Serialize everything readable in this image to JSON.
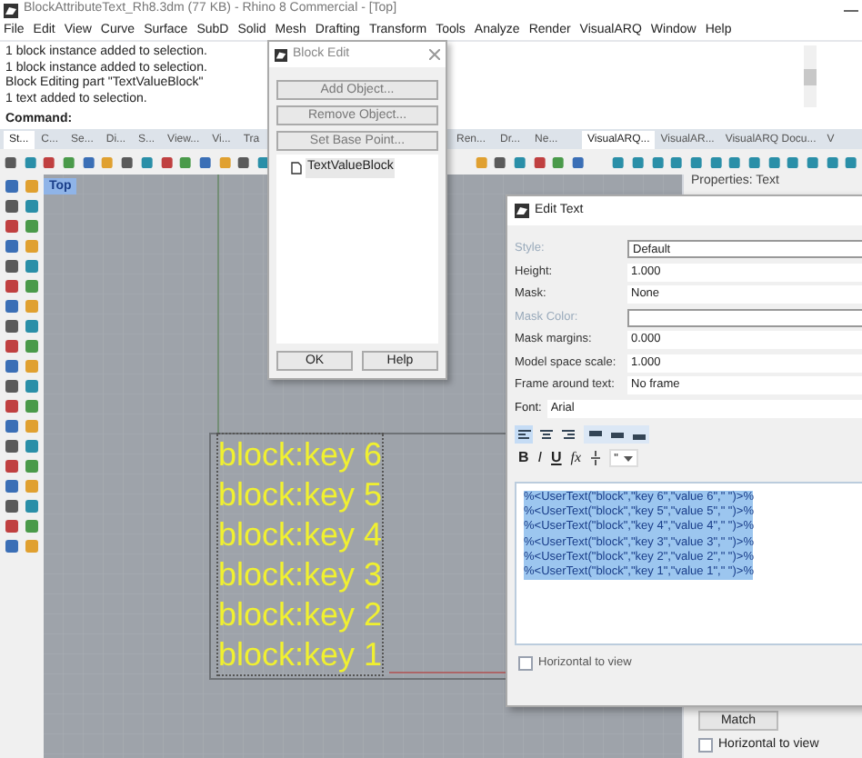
{
  "window": {
    "title": "BlockAttributeText_Rh8.3dm (77 KB) - Rhino 8 Commercial - [Top]"
  },
  "menu": [
    "File",
    "Edit",
    "View",
    "Curve",
    "Surface",
    "SubD",
    "Solid",
    "Mesh",
    "Drafting",
    "Transform",
    "Tools",
    "Analyze",
    "Render",
    "VisualARQ",
    "Window",
    "Help"
  ],
  "command_history": [
    "1 block instance added to selection.",
    "1 block instance added to selection.",
    "Block Editing part \"TextValueBlock\"",
    "1 text added to selection."
  ],
  "command_prompt": "Command:",
  "toolbar_tabs_left": [
    {
      "label": "St...",
      "selected": true
    },
    {
      "label": "C...",
      "selected": false
    },
    {
      "label": "Se...",
      "selected": false
    },
    {
      "label": "Di...",
      "selected": false
    },
    {
      "label": "S...",
      "selected": false
    },
    {
      "label": "View...",
      "selected": false
    },
    {
      "label": "Vi...",
      "selected": false
    },
    {
      "label": "Tra",
      "selected": false
    }
  ],
  "toolbar_tabs_middle": [
    {
      "label": "Ren...",
      "selected": false
    },
    {
      "label": "Dr...",
      "selected": false
    },
    {
      "label": "Ne...",
      "selected": false
    }
  ],
  "toolbar_tabs_right": [
    {
      "label": "VisualARQ...",
      "selected": true
    },
    {
      "label": "VisualAR...",
      "selected": false
    },
    {
      "label": "VisualARQ Docu...",
      "selected": false
    },
    {
      "label": "V",
      "selected": false
    }
  ],
  "viewport": {
    "label": "Top",
    "texts": [
      "block:key 6",
      "block:key 5",
      "block:key 4",
      "block:key 3",
      "block:key 2",
      "block:key 1"
    ]
  },
  "block_edit": {
    "title": "Block Edit",
    "buttons": [
      "Add Object...",
      "Remove Object...",
      "Set Base Point..."
    ],
    "tree_items": [
      "TextValueBlock"
    ],
    "footer_buttons": [
      "OK",
      "Help"
    ]
  },
  "properties": {
    "title": "Properties: Text",
    "match_button": "Match",
    "horizontal_to_view": {
      "label": "Horizontal to view",
      "checked": false
    }
  },
  "edit_text": {
    "title": "Edit Text",
    "fields": [
      {
        "label": "Style:",
        "value": "Default",
        "disabled": true
      },
      {
        "label": "Height:",
        "value": "1.000",
        "disabled": false
      },
      {
        "label": "Mask:",
        "value": "None",
        "disabled": false
      },
      {
        "label": "Mask Color:",
        "disabled": true
      },
      {
        "label": "Mask margins:",
        "value": "0.000",
        "disabled": false
      },
      {
        "label": "Model space scale:",
        "value": "1.000",
        "disabled": false
      },
      {
        "label": "Frame around text:",
        "value": "No frame",
        "disabled": false
      }
    ],
    "font": {
      "label": "Font:",
      "value": "Arial"
    },
    "horizontal_alignment": [
      {
        "selected": true
      },
      {
        "selected": false
      },
      {
        "selected": false
      }
    ],
    "vertical_alignment": [
      {
        "selected": false
      },
      {
        "selected": false
      },
      {
        "selected": false
      }
    ],
    "format_buttons": [
      {
        "label": "B",
        "kind": "bold"
      },
      {
        "label": "I",
        "kind": "italic"
      },
      {
        "label": "U",
        "kind": "underline"
      },
      {
        "label": "fx",
        "kind": "function"
      }
    ],
    "symbol_dropdown": "\"",
    "text_lines": [
      "%<UserText(\"block\",\"key 6\",\"value 6\",\" \")>%",
      "%<UserText(\"block\",\"key 5\",\"value 5\",\" \")>%",
      "%<UserText(\"block\",\"key 4\",\"value 4\",\" \")>%",
      "%<UserText(\"block\",\"key 3\",\"value 3\",\" \")>%",
      "%<UserText(\"block\",\"key 2\",\"value 2\",\" \")>%",
      "%<UserText(\"block\",\"key 1\",\"value 1\",\" \")>%"
    ],
    "text_selected": true,
    "horizontal_to_view": {
      "label": "Horizontal to view",
      "checked": false
    }
  }
}
